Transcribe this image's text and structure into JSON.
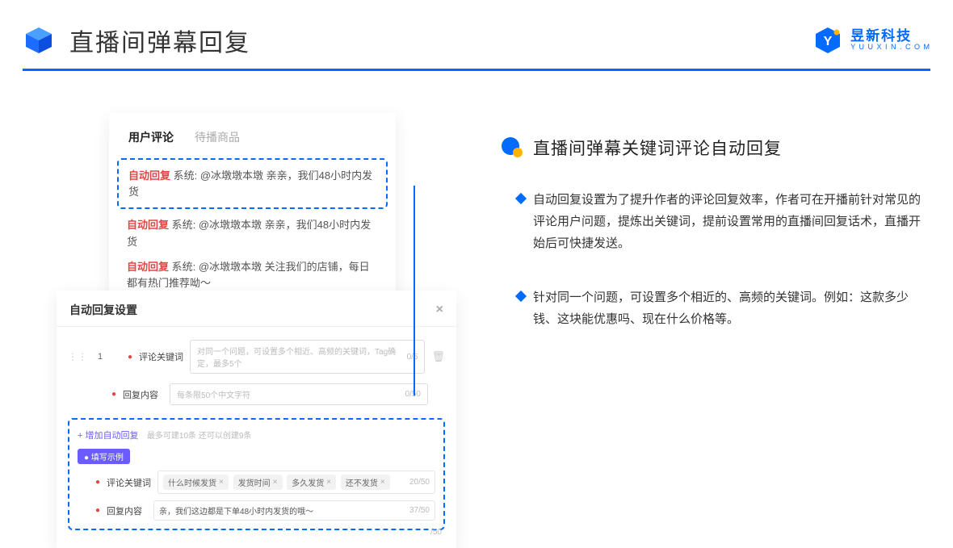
{
  "header": {
    "title": "直播间弹幕回复",
    "brand_name": "昱新科技",
    "brand_sub": "Y U U X I N . C O M"
  },
  "card1": {
    "tab_active": "用户评论",
    "tab_inactive": "待播商品",
    "auto_tag": "自动回复",
    "highlight": "系统: @冰墩墩本墩 亲亲，我们48小时内发货",
    "line2": "系统: @冰墩墩本墩 亲亲，我们48小时内发货",
    "line3": "系统: @冰墩墩本墩 关注我们的店铺，每日都有热门推荐呦～"
  },
  "card2": {
    "title": "自动回复设置",
    "row_num": "1",
    "label_keyword": "评论关键词",
    "placeholder_keyword": "对同一个问题，可设置多个相近、高频的关键词，Tag确定，最多5个",
    "counter_keyword": "0/5",
    "label_content": "回复内容",
    "placeholder_content": "每条限50个中文字符",
    "counter_content": "0/50",
    "add_link": "+ 增加自动回复",
    "hint": "最多可建10条 还可以创建9条",
    "badge": "● 填写示例",
    "ex_label_keyword": "评论关键词",
    "ex_tags": [
      "什么时候发货",
      "发货时间",
      "多久发货",
      "还不发货"
    ],
    "ex_counter_keyword": "20/50",
    "ex_label_content": "回复内容",
    "ex_content": "亲，我们这边都是下单48小时内发货的哦～",
    "ex_counter_content": "37/50",
    "bottom_counter": "/50"
  },
  "right": {
    "section_title": "直播间弹幕关键词评论自动回复",
    "bullet1": "自动回复设置为了提升作者的评论回复效率，作者可在开播前针对常见的评论用户问题，提炼出关键词，提前设置常用的直播间回复话术，直播开始后可快捷发送。",
    "bullet2": "针对同一个问题，可设置多个相近的、高频的关键词。例如：这款多少钱、这块能优惠吗、现在什么价格等。"
  }
}
